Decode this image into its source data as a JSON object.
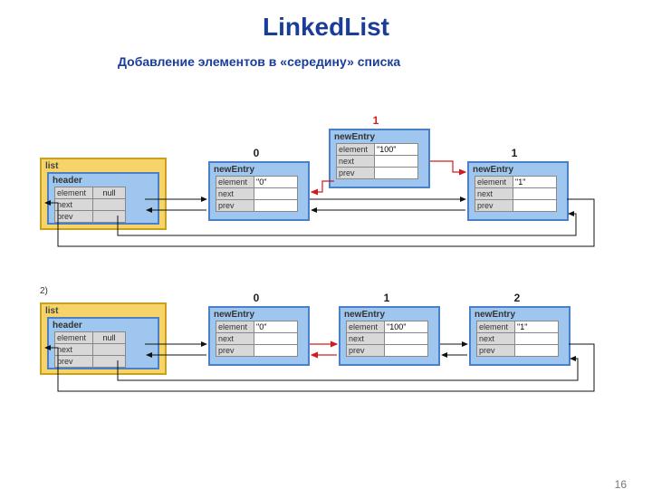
{
  "title": "LinkedList",
  "subtitle": "Добавление элементов в «середину» списка",
  "page_number": "16",
  "step2_label": "2)",
  "list_label": "list",
  "header_label": "header",
  "entry_label": "newEntry",
  "fields": {
    "element": "element",
    "next": "next",
    "prev": "prev"
  },
  "null_label": "null",
  "diagram1": {
    "insert_index": "1",
    "insert_value": "\"100\"",
    "nodes": [
      {
        "index": "0",
        "value": "\"0\""
      },
      {
        "index": "1",
        "value": "\"1\""
      }
    ]
  },
  "diagram2": {
    "nodes": [
      {
        "index": "0",
        "value": "\"0\""
      },
      {
        "index": "1",
        "value": "\"100\""
      },
      {
        "index": "2",
        "value": "\"1\""
      }
    ]
  }
}
